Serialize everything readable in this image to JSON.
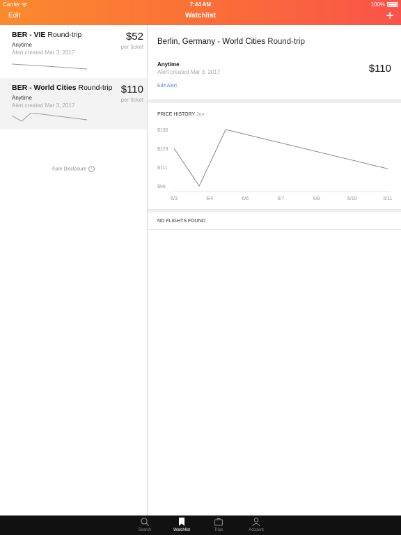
{
  "status_bar": {
    "carrier": "Carrier",
    "time": "7:44 AM",
    "battery": "100%"
  },
  "nav": {
    "edit_label": "Edit",
    "title": "Watchlist",
    "add_label": "+"
  },
  "watchlist": [
    {
      "route": "BER - VIE",
      "trip_type": "Round-trip",
      "when": "Anytime",
      "created": "Alert created Mar 3, 2017",
      "price": "$52",
      "per": "per ticket",
      "spark": [
        0.2,
        0.5,
        0.8
      ]
    },
    {
      "route": "BER - World Cities",
      "trip_type": "Round-trip",
      "when": "Anytime",
      "created": "Alert created Mar 3, 2017",
      "price": "$110",
      "per": "per ticket",
      "spark": [
        123,
        99,
        135,
        110
      ]
    }
  ],
  "fare_disclosure": "Fare Disclosure",
  "detail": {
    "title": "Berlin, Germany - World Cities",
    "trip_type": "Round-trip",
    "when": "Anytime",
    "created": "Alert created Mar 3, 2017",
    "price": "$110",
    "edit_alert": "Edit Alert",
    "price_history_label": "PRICE HISTORY",
    "price_history_month": "Jun",
    "no_flights": "NO FLIGHTS FOUND"
  },
  "chart_data": {
    "type": "line",
    "x": [
      "6/3",
      "6/4",
      "6/6",
      "6/7",
      "6/8",
      "6/10",
      "6/11"
    ],
    "y_ticks": [
      "$135",
      "$123",
      "$111",
      "$99"
    ],
    "ylim": [
      99,
      135
    ],
    "points": [
      {
        "x": "6/3",
        "y": 123
      },
      {
        "x": "6/4-",
        "y": 99
      },
      {
        "x": "6/4+",
        "y": 135
      },
      {
        "x": "6/11",
        "y": 110
      }
    ],
    "series_color": "#888888",
    "grid": false
  },
  "tabs": [
    {
      "label": "Search",
      "icon": "search-icon",
      "active": false
    },
    {
      "label": "Watchlist",
      "icon": "bookmark-icon",
      "active": true
    },
    {
      "label": "Trips",
      "icon": "briefcase-icon",
      "active": false
    },
    {
      "label": "Account",
      "icon": "person-icon",
      "active": false
    }
  ],
  "colors": {
    "accent_start": "#fb8a2e",
    "accent_end": "#f9534a",
    "link": "#4a90d9",
    "tabbar": "#111111"
  }
}
